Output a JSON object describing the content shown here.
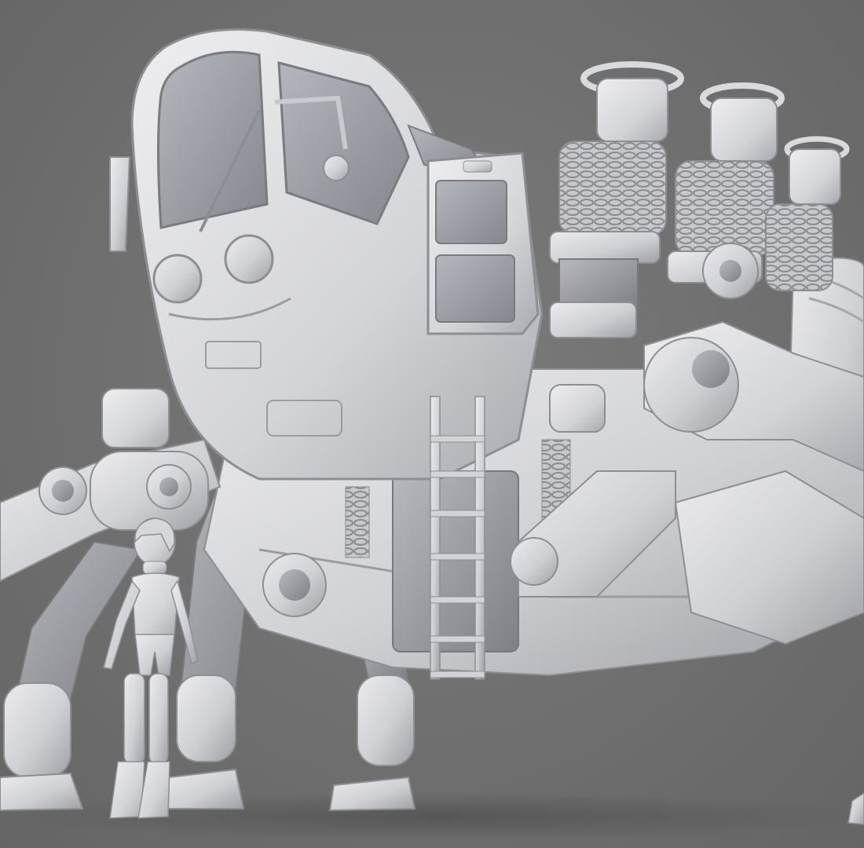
{
  "scene": {
    "subject": "mech-walker-with-pilot-figure",
    "render_style": "clay-render",
    "colors": {
      "background": "#717171",
      "clay_light": "#e4e4e6",
      "clay_mid": "#c3c4c8",
      "clay_dark": "#8c8d92",
      "glass": "#9a9da3",
      "floor_shadow": "#5a5a5a"
    }
  }
}
